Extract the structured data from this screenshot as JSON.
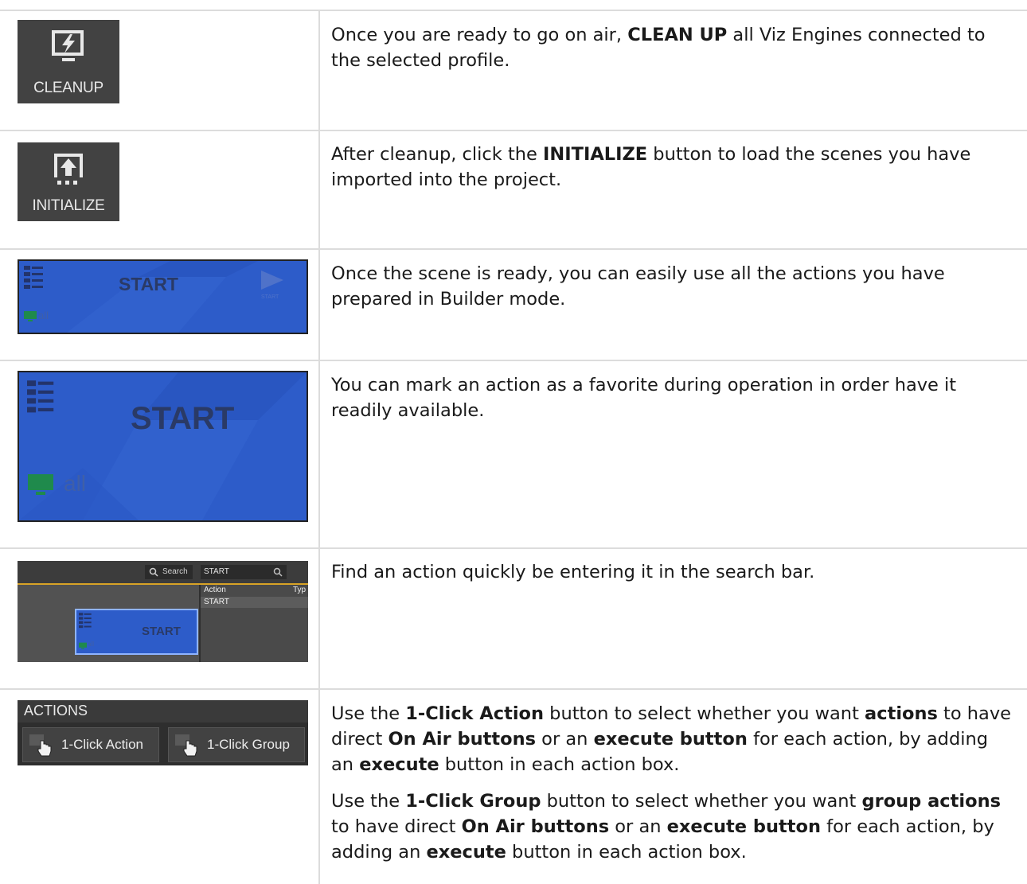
{
  "rows": [
    {
      "icon": {
        "label": "CLEANUP"
      },
      "text": [
        {
          "t": "Once you are ready to go on air, ",
          "b": false
        },
        {
          "t": "CLEAN UP",
          "b": true
        },
        {
          "t": " all Viz Engines connected to the selected profile.",
          "b": false
        }
      ]
    },
    {
      "icon": {
        "label": "INITIALIZE"
      },
      "text": [
        {
          "t": "After cleanup, click the ",
          "b": false
        },
        {
          "t": "INITIALIZE",
          "b": true
        },
        {
          "t": " button to load the scenes you have imported into the project.",
          "b": false
        }
      ]
    },
    {
      "tile": {
        "title": "START",
        "play_caption": "START",
        "channel": "all"
      },
      "text": [
        {
          "t": "Once the scene is ready, you can easily use all the actions you have prepared in Builder mode.",
          "b": false
        }
      ]
    },
    {
      "tile": {
        "title": "START",
        "channel": "all"
      },
      "text": [
        {
          "t": "You can mark an action as a favorite during operation in order have it readily available.",
          "b": false
        }
      ]
    },
    {
      "search_shot": {
        "search_button": "Search",
        "search_value": "START",
        "col_action": "Action",
        "col_type": "Typ",
        "result": "START",
        "tile_title": "START",
        "tile_channel": "all"
      },
      "text": [
        {
          "t": "Find an action quickly be entering it in the search bar.",
          "b": false
        }
      ]
    },
    {
      "actions_panel": {
        "header": "ACTIONS",
        "btn1": "1-Click Action",
        "btn2": "1-Click Group"
      },
      "para1": [
        {
          "t": "Use the ",
          "b": false
        },
        {
          "t": "1-Click Action",
          "b": true
        },
        {
          "t": " button to select whether you want ",
          "b": false
        },
        {
          "t": "actions",
          "b": true
        },
        {
          "t": " to have direct ",
          "b": false
        },
        {
          "t": "On Air buttons",
          "b": true
        },
        {
          "t": " or an ",
          "b": false
        },
        {
          "t": "execute button",
          "b": true
        },
        {
          "t": " for each action, by adding an ",
          "b": false
        },
        {
          "t": "execute",
          "b": true
        },
        {
          "t": " button in each action box.",
          "b": false
        }
      ],
      "para2": [
        {
          "t": "Use the ",
          "b": false
        },
        {
          "t": "1-Click Group",
          "b": true
        },
        {
          "t": " button to select whether you want ",
          "b": false
        },
        {
          "t": "group actions",
          "b": true
        },
        {
          "t": " to have direct ",
          "b": false
        },
        {
          "t": "On Air buttons",
          "b": true
        },
        {
          "t": " or an ",
          "b": false
        },
        {
          "t": "execute button",
          "b": true
        },
        {
          "t": " for each action, by adding an ",
          "b": false
        },
        {
          "t": "execute",
          "b": true
        },
        {
          "t": " button in each action box.",
          "b": false
        }
      ]
    }
  ],
  "colors": {
    "tile_blue": "#2d5cc9",
    "icon_dark": "#424242",
    "grid": "#dcdcdc",
    "highlight": "#d8a326"
  }
}
